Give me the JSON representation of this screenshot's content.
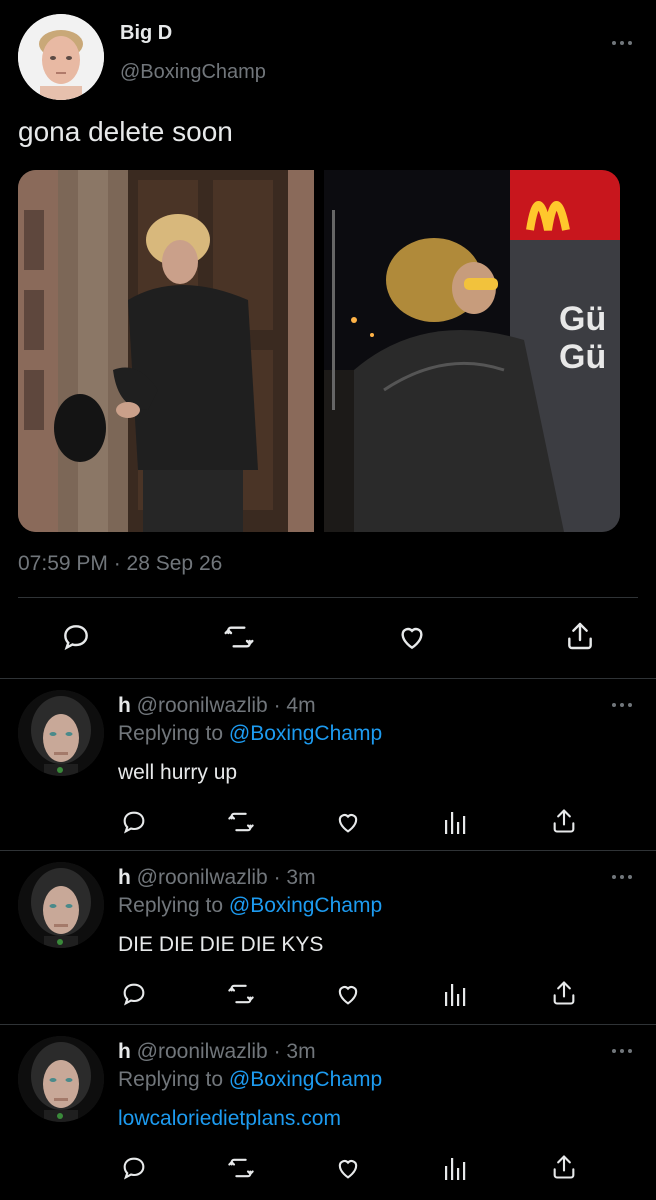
{
  "tweet": {
    "author_name": "Big D",
    "author_handle": "@BoxingChamp",
    "text": "gona delete soon",
    "timestamp": "07:59 PM · 28 Sep 26",
    "sign_text": "Gü\nGü",
    "actions": [
      "reply-icon",
      "retweet-icon",
      "like-icon",
      "share-icon"
    ]
  },
  "replies": [
    {
      "name": "h",
      "handle": "@roonilwazlib",
      "time": "· 4m",
      "replying_label": "Replying to",
      "replying_to": "@BoxingChamp",
      "text": "well hurry up",
      "is_link": false
    },
    {
      "name": "h",
      "handle": "@roonilwazlib",
      "time": "· 3m",
      "replying_label": "Replying to",
      "replying_to": "@BoxingChamp",
      "text": "DIE DIE DIE DIE KYS",
      "is_link": false
    },
    {
      "name": "h",
      "handle": "@roonilwazlib",
      "time": "· 3m",
      "replying_label": "Replying to",
      "replying_to": "@BoxingChamp",
      "text": "lowcaloriedietplans.com",
      "is_link": true
    }
  ],
  "colors": {
    "background": "#000000",
    "text": "#e7e9ea",
    "muted": "#71767b",
    "link": "#1d9bf0",
    "divider": "#2f3336",
    "brand_red": "#c8161d",
    "brand_yellow": "#ffc72c"
  }
}
